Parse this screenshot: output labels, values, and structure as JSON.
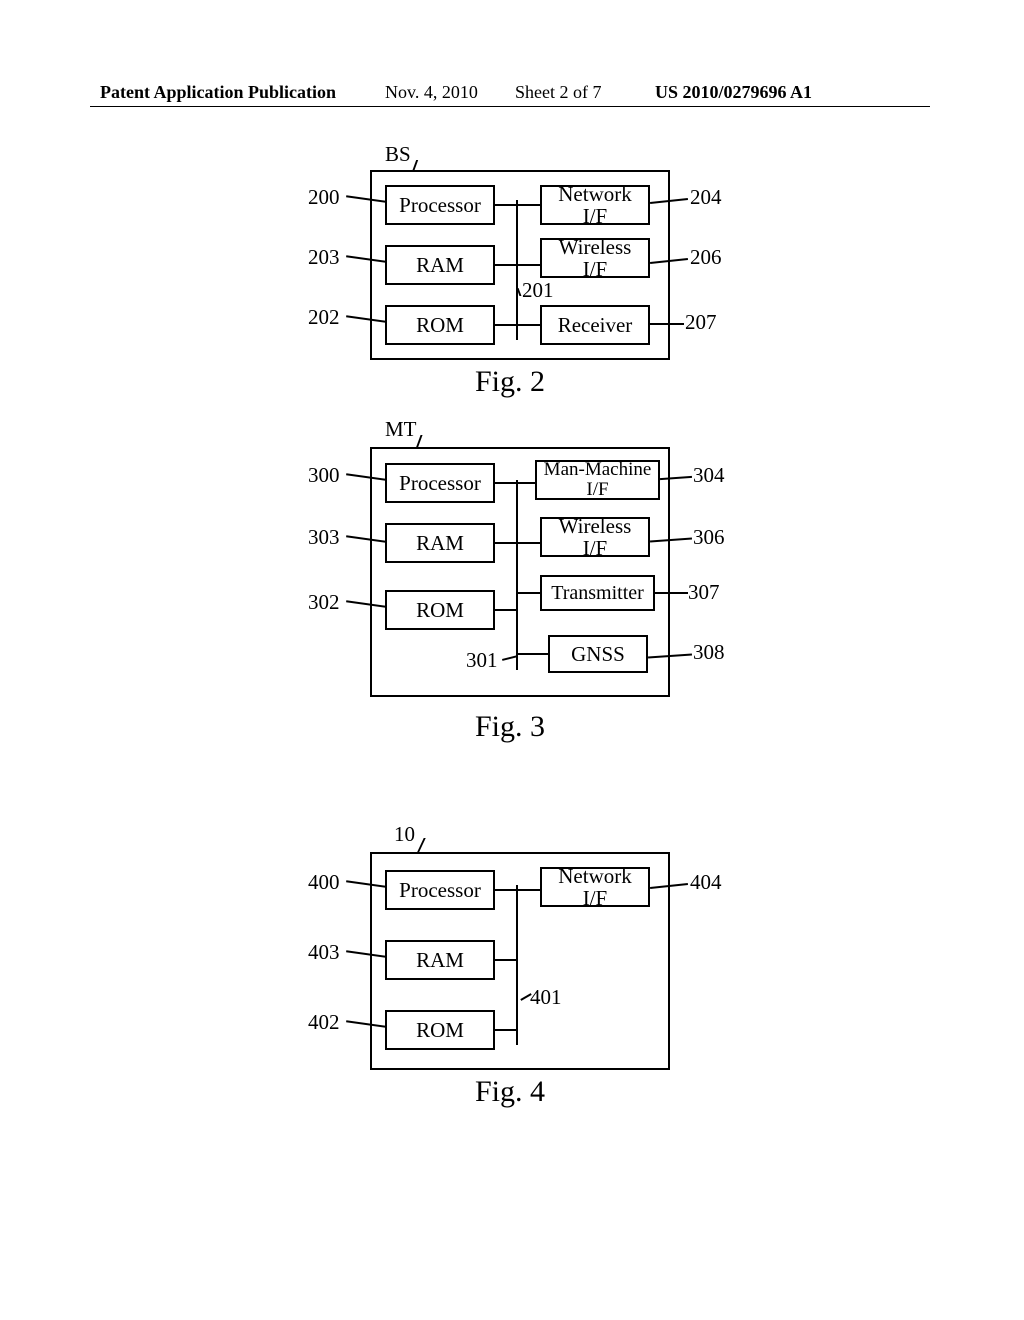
{
  "header": {
    "left": "Patent Application Publication",
    "date": "Nov. 4, 2010",
    "sheet": "Sheet 2 of 7",
    "pubno": "US 2010/0279696 A1"
  },
  "fig2": {
    "title": "BS",
    "caption": "Fig. 2",
    "boxes": {
      "processor": "Processor",
      "ram": "RAM",
      "rom": "ROM",
      "network_if": "Network\nI/F",
      "wireless_if": "Wireless\nI/F",
      "receiver": "Receiver"
    },
    "refs": {
      "r200": "200",
      "r201": "201",
      "r202": "202",
      "r203": "203",
      "r204": "204",
      "r206": "206",
      "r207": "207"
    }
  },
  "fig3": {
    "title": "MT",
    "caption": "Fig. 3",
    "boxes": {
      "processor": "Processor",
      "ram": "RAM",
      "rom": "ROM",
      "mmi": "Man-Machine\nI/F",
      "wireless_if": "Wireless\nI/F",
      "transmitter": "Transmitter",
      "gnss": "GNSS"
    },
    "refs": {
      "r300": "300",
      "r301": "301",
      "r302": "302",
      "r303": "303",
      "r304": "304",
      "r306": "306",
      "r307": "307",
      "r308": "308"
    }
  },
  "fig4": {
    "title": "10",
    "caption": "Fig. 4",
    "boxes": {
      "processor": "Processor",
      "ram": "RAM",
      "rom": "ROM",
      "network_if": "Network\nI/F"
    },
    "refs": {
      "r400": "400",
      "r401": "401",
      "r402": "402",
      "r403": "403",
      "r404": "404"
    }
  }
}
